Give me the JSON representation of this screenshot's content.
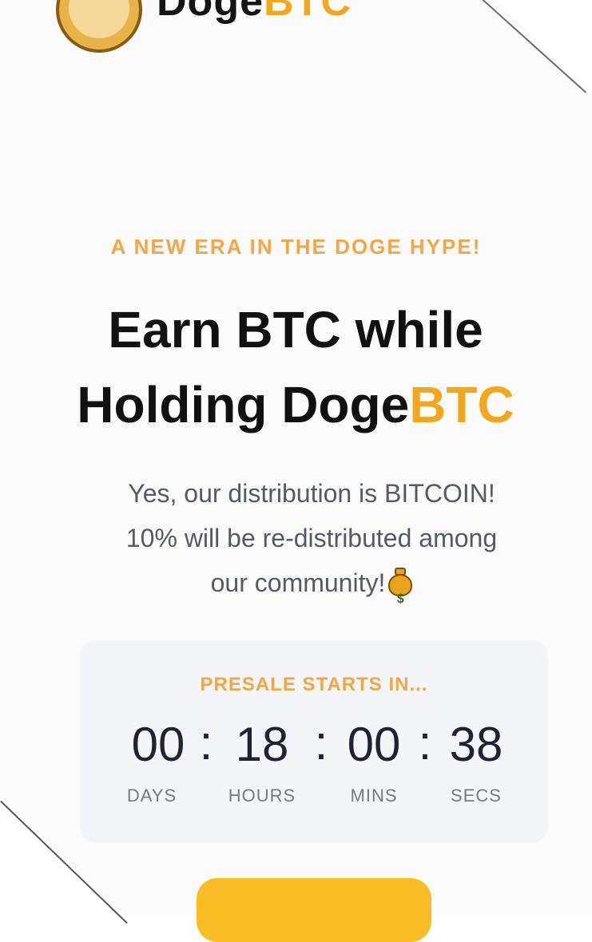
{
  "brand": {
    "name_part1": "Doge",
    "name_part2": "BTC"
  },
  "hero": {
    "eyebrow": "A NEW ERA IN THE DOGE HYPE!",
    "headline_line1": "Earn BTC while",
    "headline_line2_a": "Holding Doge",
    "headline_line2_b": "BTC",
    "description_line1": "Yes, our distribution is BITCOIN!",
    "description_line2": "10% will be re-distributed among",
    "description_line3": "our community!"
  },
  "countdown": {
    "title": "PRESALE STARTS IN...",
    "days": "00",
    "hours": "18",
    "mins": "00",
    "secs": "38",
    "separator": ":",
    "label_days": "DAYS",
    "label_hours": "HOURS",
    "label_mins": "MINS",
    "label_secs": "SECS"
  },
  "icons": {
    "bag": "money-bag-icon",
    "logo": "doge-coin-logo-icon"
  },
  "colors": {
    "accent": "#f2a81d",
    "eyebrow": "#f2a646",
    "cta": "#f7bd22",
    "panel": "#f3f5f8"
  }
}
